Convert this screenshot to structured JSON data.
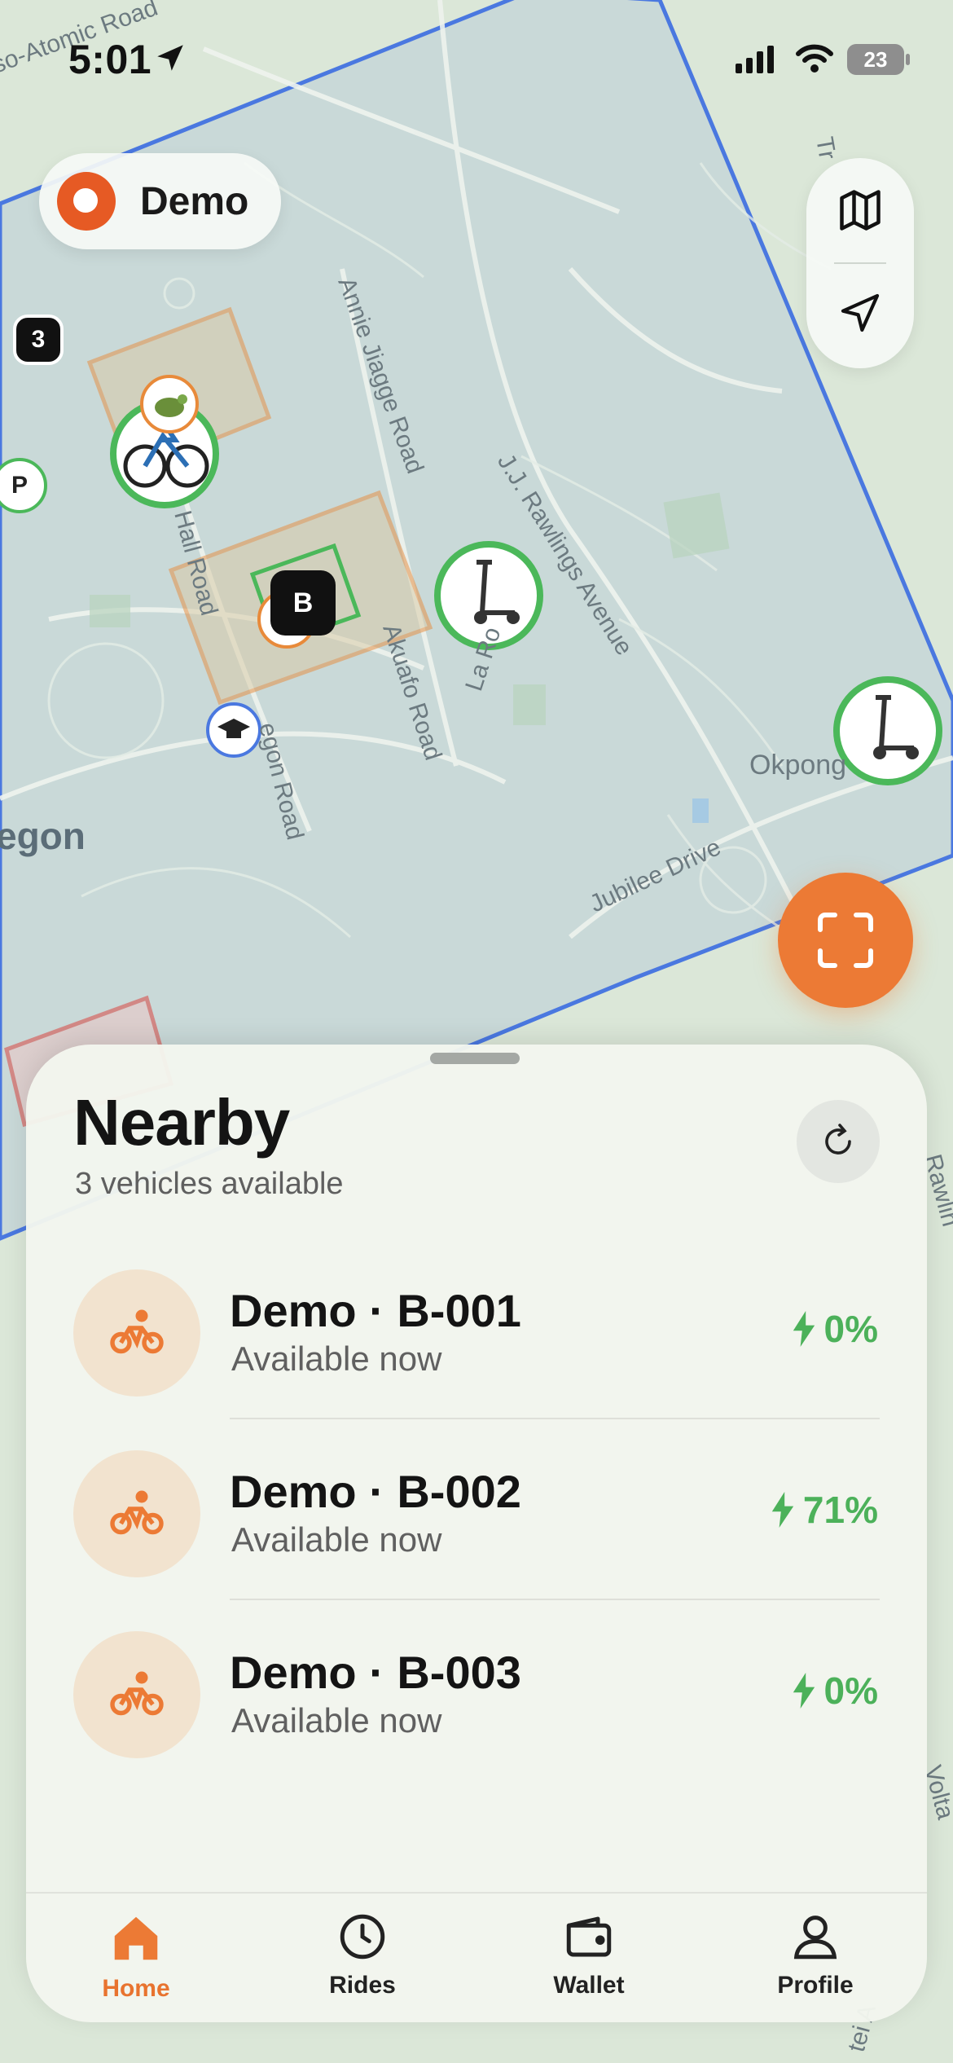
{
  "status_bar": {
    "time": "5:01",
    "battery": "23"
  },
  "brand": {
    "name": "Demo"
  },
  "map": {
    "cluster_count": "3",
    "parking_label": "P",
    "building_label": "B",
    "labels": {
      "road1": "Annie Jiagge Road",
      "road2": "J.J. Rawlings Avenue",
      "road3": "Hall Road",
      "road4": "Akuafo Road",
      "road5": "La Ro",
      "road6": "egon Road",
      "road7": "Jubilee Drive",
      "road8": "Okpong",
      "road9": "so-Atomic Road",
      "area1": "egon",
      "edge1": "Rawlin",
      "edge2": "Volta",
      "edge3": "tei A",
      "edge4": "Tr"
    }
  },
  "sheet": {
    "title": "Nearby",
    "subtitle": "3 vehicles available",
    "vehicles": [
      {
        "name": "Demo · B-001",
        "status": "Available now",
        "battery": "0%"
      },
      {
        "name": "Demo · B-002",
        "status": "Available now",
        "battery": "71%"
      },
      {
        "name": "Demo · B-003",
        "status": "Available now",
        "battery": "0%"
      }
    ]
  },
  "tabs": [
    {
      "label": "Home",
      "icon": "home-icon",
      "active": true
    },
    {
      "label": "Rides",
      "icon": "clock-icon",
      "active": false
    },
    {
      "label": "Wallet",
      "icon": "wallet-icon",
      "active": false
    },
    {
      "label": "Profile",
      "icon": "person-icon",
      "active": false
    }
  ],
  "colors": {
    "accent": "#EC7A35",
    "battery_green": "#4CB15A",
    "zone_blue": "#4A78E0",
    "zone_orange": "#E88A3A",
    "zone_red": "#D9534F"
  }
}
